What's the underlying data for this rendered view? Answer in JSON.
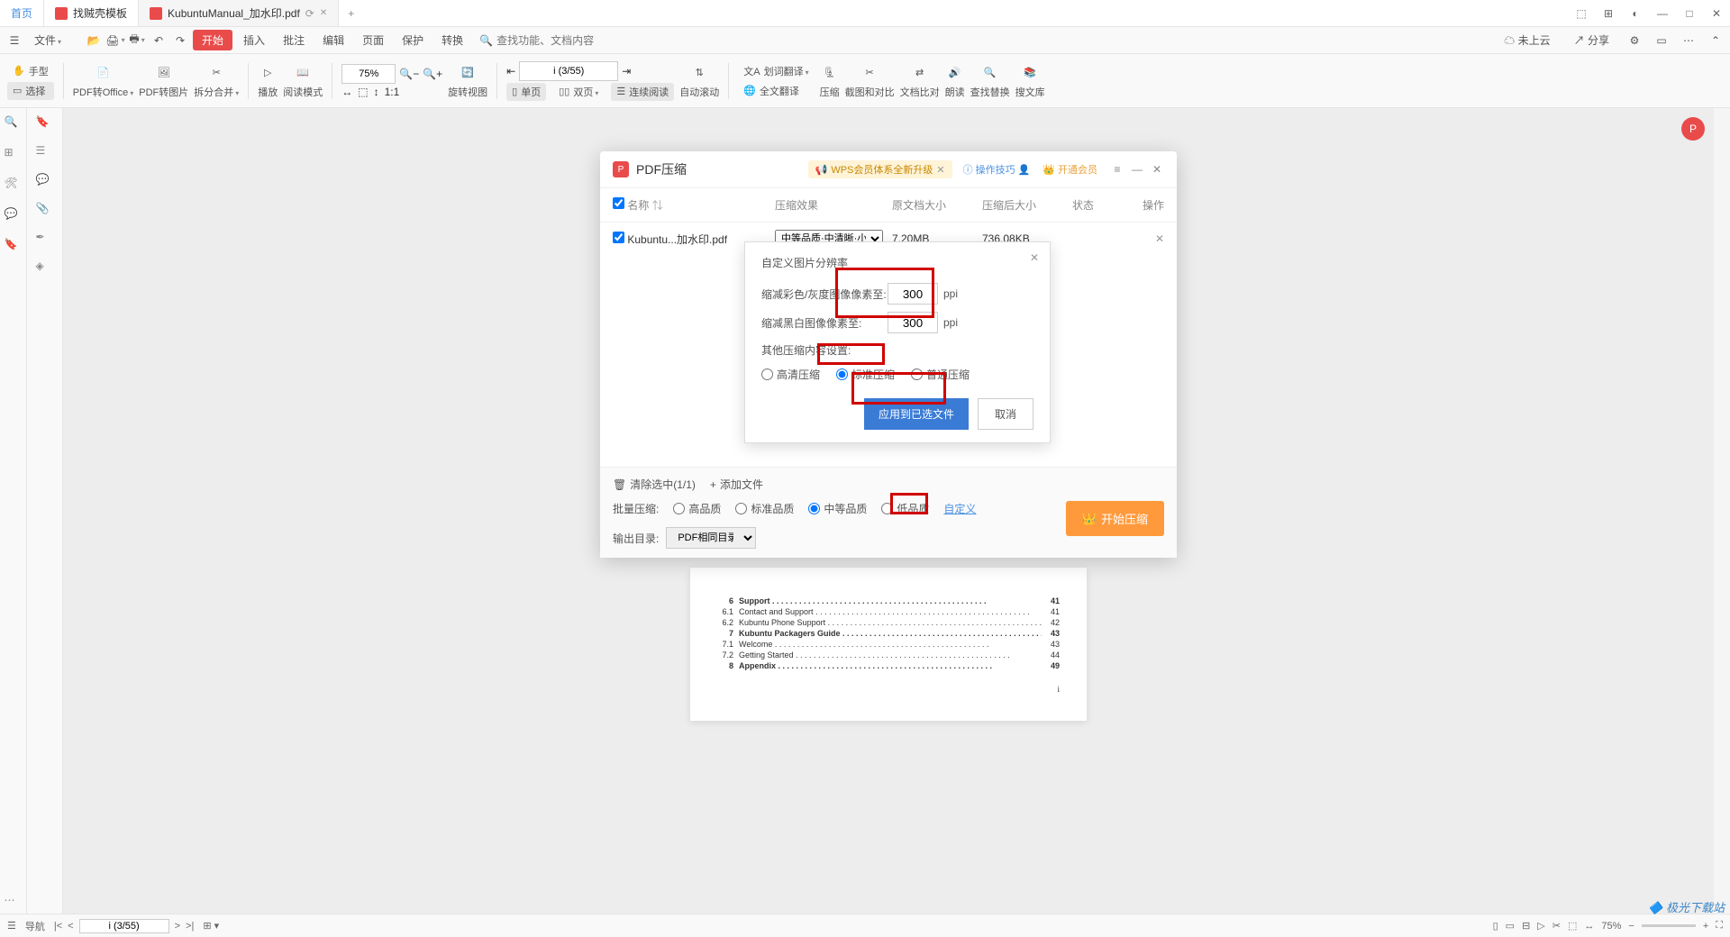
{
  "tabs": {
    "home": "首页",
    "t1": "找贼壳模板",
    "t2": "KubuntuManual_加水印.pdf"
  },
  "winControls": {
    "layout2": "⬚",
    "layout": "⊞",
    "circle": "◐",
    "min": "—",
    "max": "□",
    "close": "✕"
  },
  "menubar": {
    "file": "文件",
    "start": "开始",
    "insert": "插入",
    "review": "批注",
    "edit": "编辑",
    "page": "页面",
    "protect": "保护",
    "convert": "转换",
    "searchPlaceholder": "查找功能、文档内容",
    "notCloud": "未上云",
    "share": "分享"
  },
  "ribbon": {
    "hand": "手型",
    "select": "选择",
    "pdfToOffice": "PDF转Office",
    "pdfToImage": "PDF转图片",
    "splitMerge": "拆分合并",
    "play": "播放",
    "readMode": "阅读模式",
    "zoom": "75%",
    "rotateView": "旋转视图",
    "singlePage": "单页",
    "doublePage": "双页",
    "continuous": "连续阅读",
    "autoScroll": "自动滚动",
    "wordTranslate": "划词翻译",
    "fullTranslate": "全文翻译",
    "compress": "压缩",
    "screenshot": "截图和对比",
    "compare": "文档比对",
    "read": "朗读",
    "findReplace": "查找替换",
    "docLib": "搜文库",
    "pageIndicator": "i (3/55)"
  },
  "dialog": {
    "title": "PDF压缩",
    "badge": "WPS会员体系全新升级",
    "tips": "操作技巧",
    "vip": "开通会员",
    "cols": {
      "name": "名称",
      "effect": "压缩效果",
      "origSize": "原文档大小",
      "compSize": "压缩后大小",
      "status": "状态",
      "ops": "操作"
    },
    "row": {
      "file": "Kubuntu...加水印.pdf",
      "effect": "中等品质·中清晰·小体积",
      "orig": "7.20MB",
      "comp": "736.08KB"
    },
    "clearSelected": "清除选中(1/1)",
    "addFile": "添加文件",
    "batch": "批量压缩:",
    "q1": "高品质",
    "q2": "标准品质",
    "q3": "中等品质",
    "q4": "低品质",
    "custom": "自定义",
    "outdir": "输出目录:",
    "outdirVal": "PDF相同目录",
    "startBtn": "开始压缩"
  },
  "subdialog": {
    "title": "自定义图片分辨率",
    "row1": "缩减彩色/灰度图像像素至:",
    "row2": "缩减黑白图像像素至:",
    "val1": "300",
    "val2": "300",
    "unit": "ppi",
    "other": "其他压缩内容设置:",
    "r1": "高清压缩",
    "r2": "标准压缩",
    "r3": "普通压缩",
    "apply": "应用到已选文件",
    "cancel": "取消"
  },
  "toc": [
    {
      "n": "6",
      "t": "Support",
      "p": "41",
      "head": true
    },
    {
      "n": "6.1",
      "t": "Contact and Support",
      "p": "41"
    },
    {
      "n": "6.2",
      "t": "Kubuntu Phone Support",
      "p": "42"
    },
    {
      "n": "7",
      "t": "Kubuntu Packagers Guide",
      "p": "43",
      "head": true
    },
    {
      "n": "7.1",
      "t": "Welcome",
      "p": "43"
    },
    {
      "n": "7.2",
      "t": "Getting Started",
      "p": "44"
    },
    {
      "n": "8",
      "t": "Appendix",
      "p": "49",
      "head": true
    }
  ],
  "statusbar": {
    "nav": "导航",
    "page": "i (3/55)",
    "zoom": "75%"
  },
  "watermark": "极光下载站"
}
